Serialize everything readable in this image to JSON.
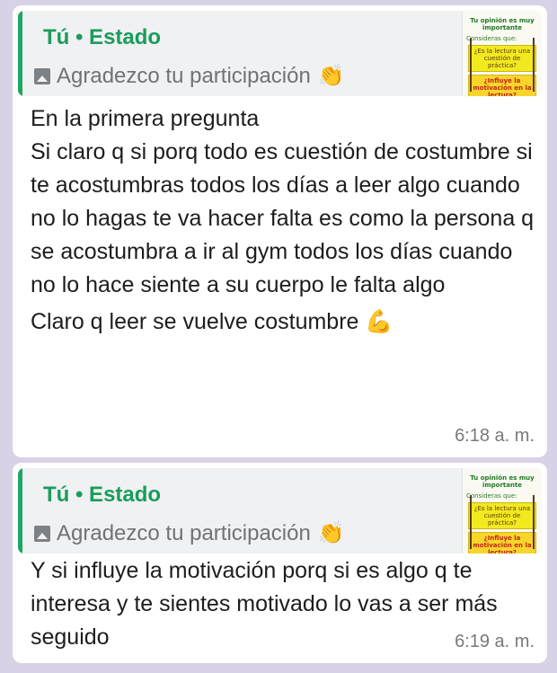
{
  "messages": [
    {
      "reply": {
        "author": "Tú • Estado",
        "caption": "Agradezco tu participación",
        "emoji": "👏",
        "thumbnail": {
          "header": "Tu opinión es muy importante",
          "prompt": "Consideras que:",
          "q1": "¿Es la lectura una cuestión de práctica?",
          "q2": "¿Influye la motivación en la lectura?"
        }
      },
      "paragraphs": [
        "En la primera pregunta\nSi claro q si porq todo es cuestión de costumbre si te acostumbras todos los días a leer algo cuando no lo hagas te va hacer falta es como la persona q se acostumbra a ir al gym todos los días cuando no lo hace siente a su cuerpo le falta algo",
        "Claro q leer se vuelve costumbre"
      ],
      "trailing_emoji": "💪",
      "time": "6:18 a. m."
    },
    {
      "reply": {
        "author": "Tú • Estado",
        "caption": "Agradezco tu participación",
        "emoji": "👏",
        "thumbnail": {
          "header": "Tu opinión es muy importante",
          "prompt": "Consideras que:",
          "q1": "¿Es la lectura una cuestión de práctica?",
          "q2": "¿Influye la motivación en la lectura?"
        }
      },
      "paragraphs": [
        "Y si influye la motivación porq si es algo q te interesa y te sientes motivado lo vas a ser más seguido"
      ],
      "time": "6:19 a. m."
    }
  ],
  "colors": {
    "background": "#d9d2e6",
    "bubble": "#ffffff",
    "quote_bar": "#1da860",
    "author": "#1a9c5c"
  }
}
